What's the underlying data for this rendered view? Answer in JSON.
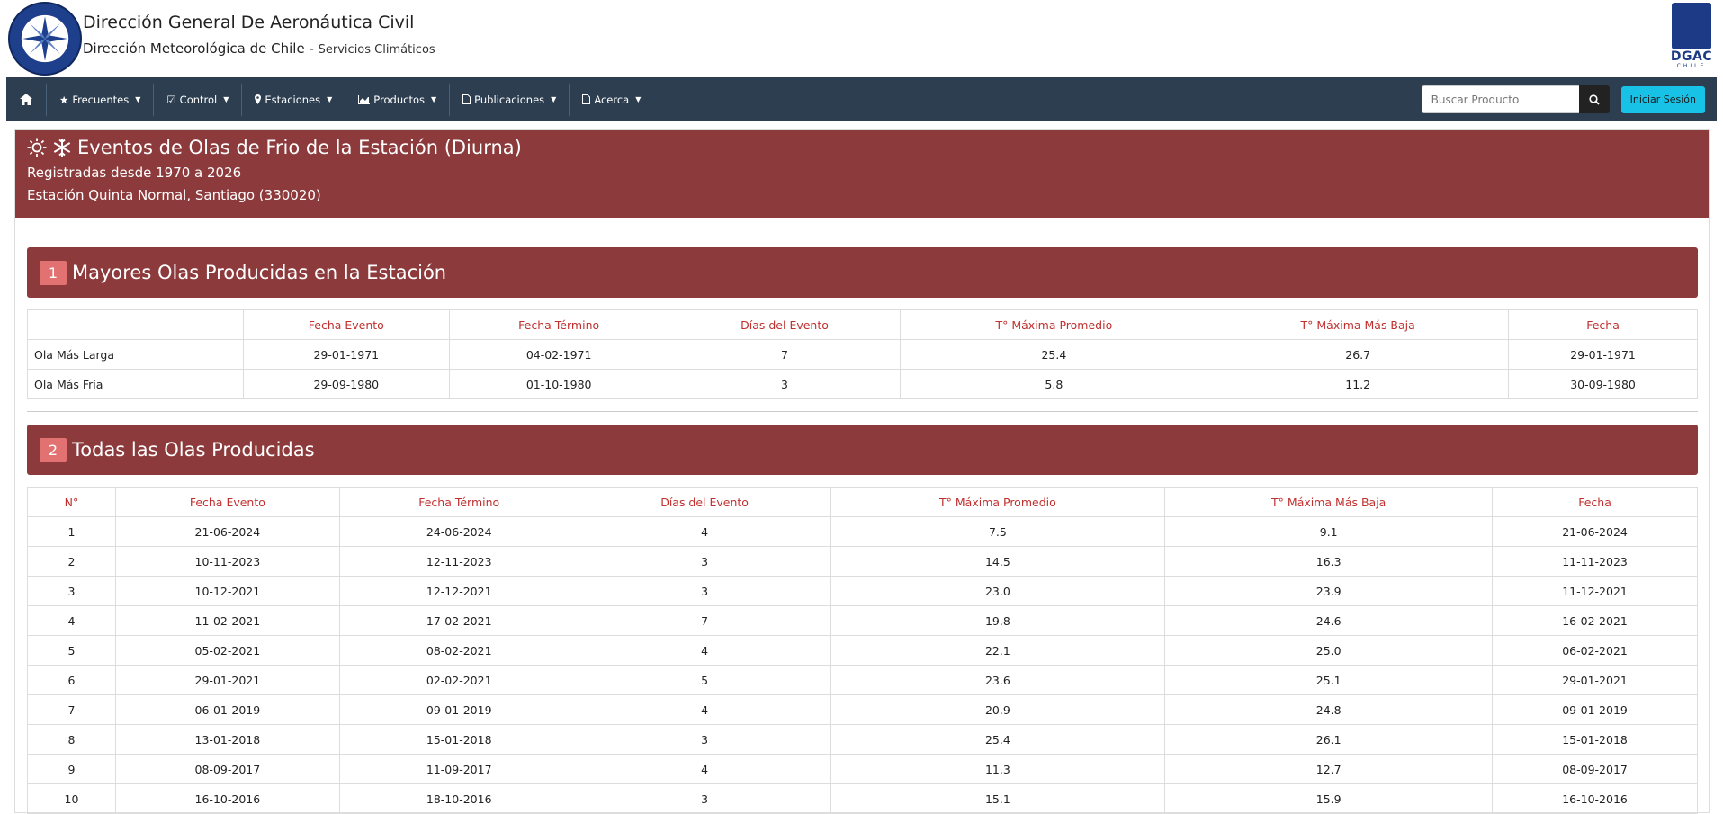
{
  "header": {
    "title": "Dirección General De Aeronáutica Civil",
    "subtitle_main": "Dirección Meteorológica de Chile",
    "subtitle_sep": " - ",
    "subtitle_small": "Servicios Climáticos",
    "right_logo_text": "DGAC",
    "right_logo_sub": "CHILE"
  },
  "nav": {
    "items": [
      {
        "label": "Frecuentes",
        "icon": "star-icon"
      },
      {
        "label": "Control",
        "icon": "checkbox-icon"
      },
      {
        "label": "Estaciones",
        "icon": "map-marker-icon"
      },
      {
        "label": "Productos",
        "icon": "area-chart-icon"
      },
      {
        "label": "Publicaciones",
        "icon": "pdf-file-icon"
      },
      {
        "label": "Acerca",
        "icon": "pdf-file-icon"
      }
    ],
    "search_placeholder": "Buscar Producto",
    "login_label": "Iniciar Sesión"
  },
  "page": {
    "title": "Eventos de Olas de Frio de la Estación (Diurna)",
    "registered": "Registradas desde 1970 a 2026",
    "station": "Estación Quinta Normal, Santiago (330020)"
  },
  "section1": {
    "num": "1",
    "title": "Mayores Olas Producidas en la Estación",
    "headers": [
      "",
      "Fecha Evento",
      "Fecha Término",
      "Días del Evento",
      "T° Máxima Promedio",
      "T° Máxima Más Baja",
      "Fecha"
    ],
    "rows": [
      [
        "Ola Más Larga",
        "29-01-1971",
        "04-02-1971",
        "7",
        "25.4",
        "26.7",
        "29-01-1971"
      ],
      [
        "Ola Más Fría",
        "29-09-1980",
        "01-10-1980",
        "3",
        "5.8",
        "11.2",
        "30-09-1980"
      ]
    ]
  },
  "section2": {
    "num": "2",
    "title": "Todas las Olas Producidas",
    "headers": [
      "N°",
      "Fecha Evento",
      "Fecha Término",
      "Días del Evento",
      "T° Máxima Promedio",
      "T° Máxima Más Baja",
      "Fecha"
    ],
    "rows": [
      [
        "1",
        "21-06-2024",
        "24-06-2024",
        "4",
        "7.5",
        "9.1",
        "21-06-2024"
      ],
      [
        "2",
        "10-11-2023",
        "12-11-2023",
        "3",
        "14.5",
        "16.3",
        "11-11-2023"
      ],
      [
        "3",
        "10-12-2021",
        "12-12-2021",
        "3",
        "23.0",
        "23.9",
        "11-12-2021"
      ],
      [
        "4",
        "11-02-2021",
        "17-02-2021",
        "7",
        "19.8",
        "24.6",
        "16-02-2021"
      ],
      [
        "5",
        "05-02-2021",
        "08-02-2021",
        "4",
        "22.1",
        "25.0",
        "06-02-2021"
      ],
      [
        "6",
        "29-01-2021",
        "02-02-2021",
        "5",
        "23.6",
        "25.1",
        "29-01-2021"
      ],
      [
        "7",
        "06-01-2019",
        "09-01-2019",
        "4",
        "20.9",
        "24.8",
        "09-01-2019"
      ],
      [
        "8",
        "13-01-2018",
        "15-01-2018",
        "3",
        "25.4",
        "26.1",
        "15-01-2018"
      ],
      [
        "9",
        "08-09-2017",
        "11-09-2017",
        "4",
        "11.3",
        "12.7",
        "08-09-2017"
      ],
      [
        "10",
        "16-10-2016",
        "18-10-2016",
        "3",
        "15.1",
        "15.9",
        "16-10-2016"
      ]
    ]
  },
  "colors": {
    "navbar": "#2c3e50",
    "panel_header": "#8c3a3b",
    "section_badge": "#e27272",
    "table_header_text": "#c0302f",
    "login_button": "#17c2e6"
  }
}
